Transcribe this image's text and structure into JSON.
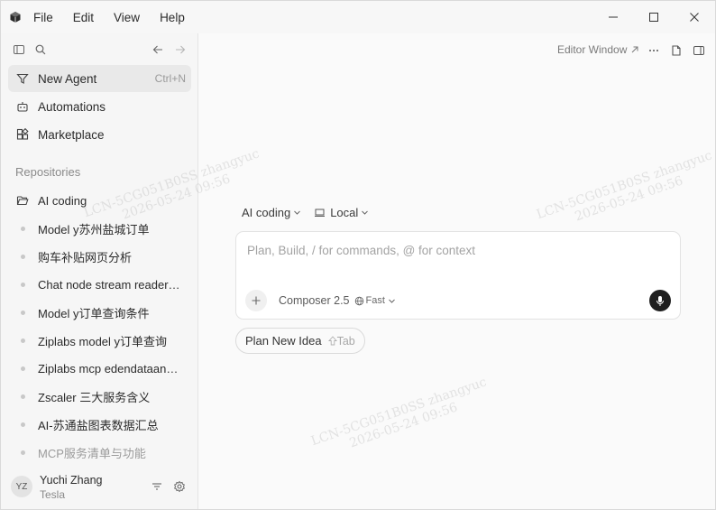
{
  "menu": {
    "file": "File",
    "edit": "Edit",
    "view": "View",
    "help": "Help"
  },
  "sidebar": {
    "nav": [
      {
        "label": "New Agent",
        "shortcut": "Ctrl+N"
      },
      {
        "label": "Automations"
      },
      {
        "label": "Marketplace"
      }
    ],
    "repositories_title": "Repositories",
    "repo_folder": "AI coding",
    "repos": [
      "Model y苏州盐城订单",
      "购车补贴网页分析",
      "Chat node stream reader ...",
      "Model y订单查询条件",
      "Ziplabs model y订单查询",
      "Ziplabs mcp edendataana...",
      "Zscaler 三大服务含义",
      "AI-苏通盐图表数据汇总",
      "MCP服务清单与功能"
    ],
    "user": {
      "initials": "YZ",
      "name": "Yuchi Zhang",
      "org": "Tesla"
    }
  },
  "main": {
    "editor_window": "Editor Window",
    "project_selector": "AI coding",
    "env_selector": "Local",
    "composer": {
      "placeholder": "Plan, Build, / for commands, @ for context",
      "model": "Composer 2.5",
      "speed": "Fast"
    },
    "plan_button": {
      "label": "Plan New Idea",
      "hint": "Tab"
    }
  },
  "watermark": {
    "line1": "LCN-5CG051B0SS zhangyuc",
    "line2": "2026-05-24 09:56"
  },
  "colors": {
    "accent_dark": "#1f1f1f",
    "sidebar_bg": "#f6f6f6",
    "main_bg": "#fafafa"
  }
}
